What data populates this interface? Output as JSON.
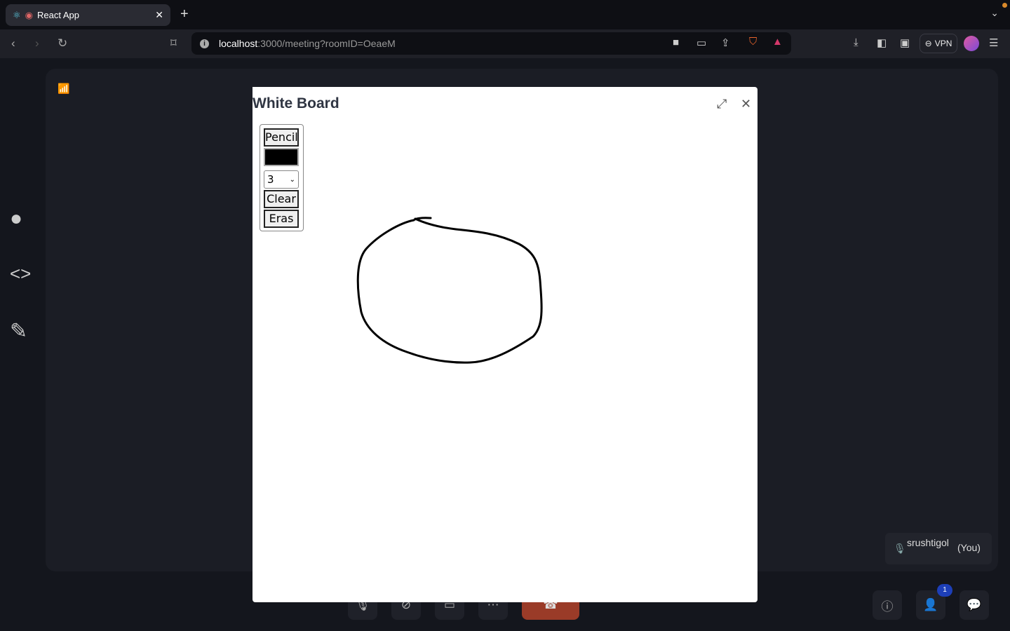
{
  "browser": {
    "tab_title": "React App",
    "url_host": "localhost",
    "url_path": ":3000/meeting?roomID=OeaeM",
    "vpn_label": "VPN"
  },
  "whiteboard": {
    "title": "White Board",
    "tools": {
      "pencil": "Pencil",
      "color": "#000000",
      "size": "3",
      "clear": "Clear",
      "eraser": "Eras"
    }
  },
  "participant": {
    "name": "srushtigol",
    "you": "(You)"
  },
  "participants_count": "1",
  "colors": {
    "end_call": "#9a3b28",
    "badge": "#1d3fb8"
  }
}
